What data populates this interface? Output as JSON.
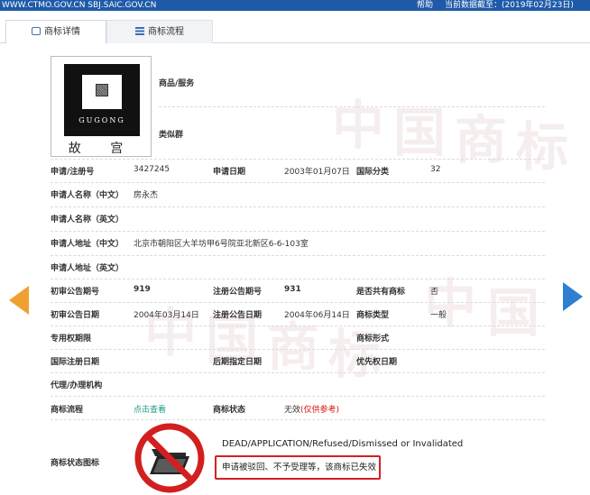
{
  "topbar": {
    "site_links": "WWW.CTMO.GOV.CN  SBJ.SAIC.GOV.CN",
    "help": "帮助",
    "data_as_of": "当前数据截至：(2019年02月23日)"
  },
  "tabs": [
    {
      "label": "商标详情",
      "icon": "tag-icon",
      "active": true
    },
    {
      "label": "商标流程",
      "icon": "list-icon",
      "active": false
    }
  ],
  "watermark_chars": [
    "中",
    "国",
    "商",
    "标"
  ],
  "mark_image": {
    "latin_text": "GUGONG",
    "chinese_text": "故  宫"
  },
  "labels": {
    "goods_services": "商品/服务",
    "similar_group": "类似群",
    "reg_no": "申请/注册号",
    "app_date": "申请日期",
    "intl_class": "国际分类",
    "applicant_cn": "申请人名称（中文）",
    "applicant_en": "申请人名称（英文）",
    "address_cn": "申请人地址（中文）",
    "address_en": "申请人地址（英文）",
    "prelim_pub_no": "初审公告期号",
    "reg_pub_no": "注册公告期号",
    "shared": "是否共有商标",
    "prelim_pub_date": "初审公告日期",
    "reg_pub_date": "注册公告日期",
    "mark_type": "商标类型",
    "exclusive_period": "专用权期限",
    "mark_form": "商标形式",
    "intl_reg_date": "国际注册日期",
    "later_designation_date": "后期指定日期",
    "priority_date": "优先权日期",
    "agent": "代理/办理机构",
    "process": "商标流程",
    "status": "商标状态",
    "status_icon": "商标状态图标"
  },
  "values": {
    "reg_no": "3427245",
    "app_date": "2003年01月07日",
    "intl_class": "32",
    "applicant_cn": "房永杰",
    "address_cn": "北京市朝阳区大羊坊甲6号院亚北新区6-6-103室",
    "prelim_pub_no": "919",
    "reg_pub_no": "931",
    "shared": "否",
    "prelim_pub_date": "2004年03月14日",
    "reg_pub_date": "2004年06月14日",
    "mark_type": "一般",
    "process_link": "点击查看",
    "status": "无效",
    "status_note": "(仅供参考)"
  },
  "status_panel": {
    "icon": "no-folder-icon",
    "english": "DEAD/APPLICATION/Refused/Dismissed or Invalidated",
    "notice": "申请被驳回、不予受理等，该商标已失效"
  },
  "colors": {
    "topbar": "#1e5aa8",
    "link": "#1a9a86",
    "status_red": "#d11",
    "arrow_prev": "#f0a030",
    "arrow_next": "#2f7fd0"
  }
}
